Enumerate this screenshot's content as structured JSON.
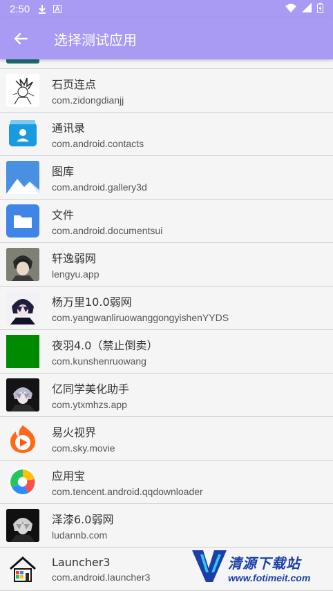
{
  "status_bar": {
    "time": "2:50"
  },
  "app_bar": {
    "title": "选择测试应用"
  },
  "apps": [
    {
      "name": "",
      "package": "",
      "icon": "teal-app-icon"
    },
    {
      "name": "石页连点",
      "package": "com.zidongdianjj",
      "icon": "sketch-character-icon"
    },
    {
      "name": "通讯录",
      "package": "com.android.contacts",
      "icon": "contacts-icon"
    },
    {
      "name": "图库",
      "package": "com.android.gallery3d",
      "icon": "gallery-icon"
    },
    {
      "name": "文件",
      "package": "com.android.documentsui",
      "icon": "folder-icon"
    },
    {
      "name": "轩逸弱网",
      "package": "lengyu.app",
      "icon": "anime-avatar-icon"
    },
    {
      "name": "杨万里10.0弱网",
      "package": "com.yangwanliruowanggongyishenYYDS",
      "icon": "anime-avatar-icon"
    },
    {
      "name": "夜羽4.0（禁止倒卖）",
      "package": "com.kunshenruowang",
      "icon": "green-square-icon"
    },
    {
      "name": "亿同学美化助手",
      "package": "com.ytxmhzs.app",
      "icon": "anime-avatar-icon"
    },
    {
      "name": "易火视界",
      "package": "com.sky.movie",
      "icon": "play-flame-icon"
    },
    {
      "name": "应用宝",
      "package": "com.tencent.android.qqdownloader",
      "icon": "app-store-icon"
    },
    {
      "name": "泽漆6.0弱网",
      "package": "ludannb.com",
      "icon": "anime-avatar-icon"
    },
    {
      "name": "Launcher3",
      "package": "com.android.launcher3",
      "icon": "house-icon"
    }
  ],
  "watermark": {
    "title": "清源下载站",
    "url": "www.fotimeit.com"
  },
  "colors": {
    "accent": "#a99af3",
    "divider": "#cfcfcf",
    "background": "#f5f5f5"
  }
}
